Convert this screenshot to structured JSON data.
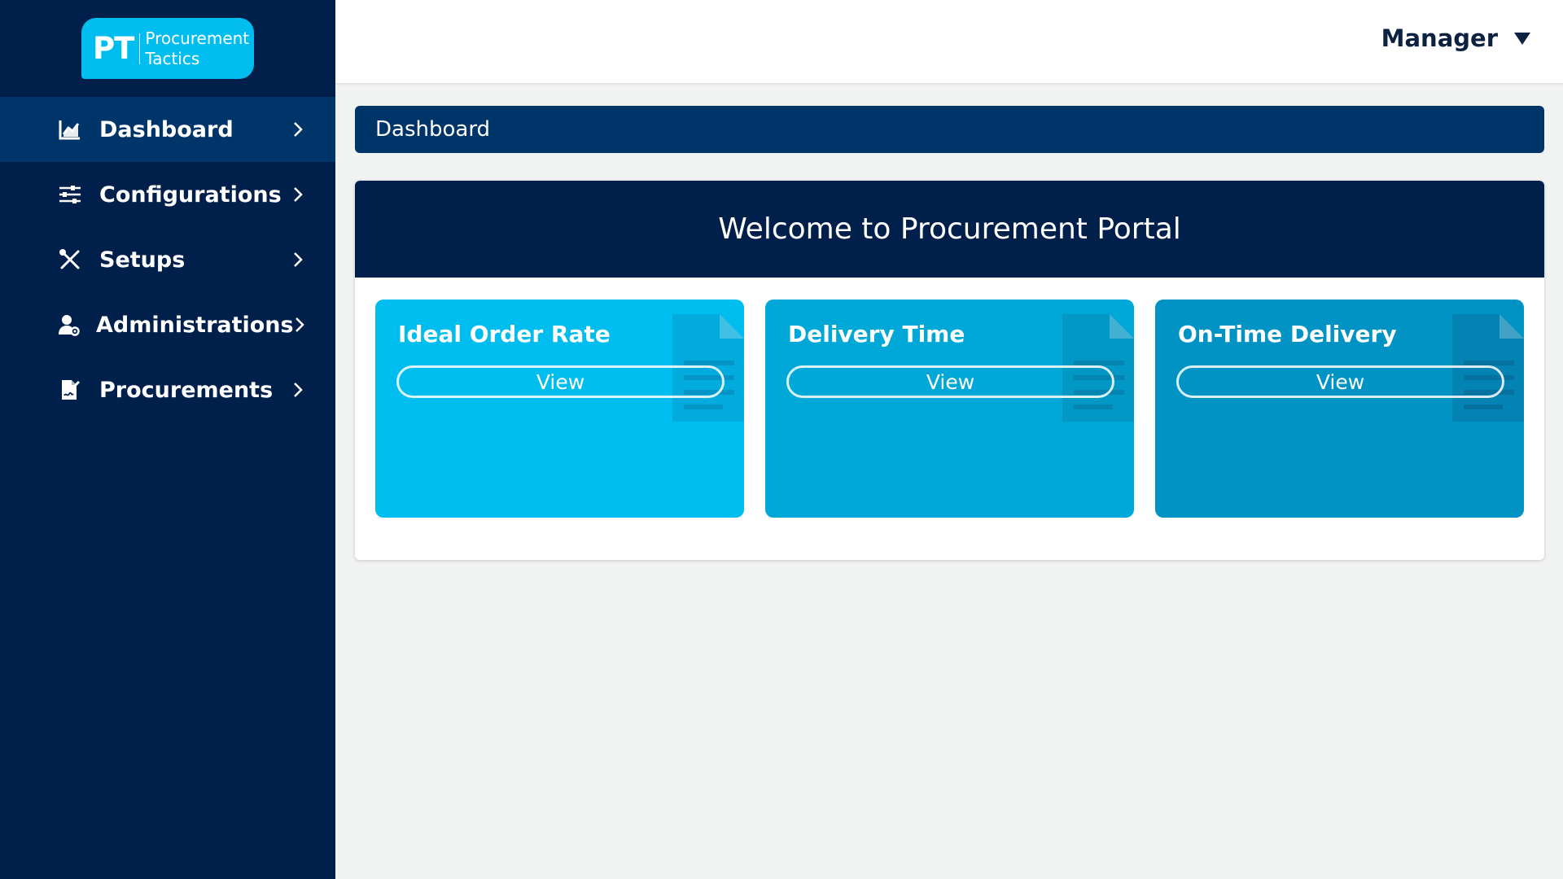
{
  "logo": {
    "mark": "PT",
    "line1": "Procurement",
    "line2": "Tactics"
  },
  "sidebar": {
    "items": [
      {
        "label": "Dashboard",
        "icon": "chart-line-icon",
        "active": true
      },
      {
        "label": "Configurations",
        "icon": "sliders-icon",
        "active": false
      },
      {
        "label": "Setups",
        "icon": "tools-icon",
        "active": false
      },
      {
        "label": "Administrations",
        "icon": "user-gear-icon",
        "active": false
      },
      {
        "label": "Procurements",
        "icon": "file-signature-icon",
        "active": false
      }
    ]
  },
  "header": {
    "user": "Manager",
    "caret_icon": "caret-down-icon"
  },
  "breadcrumb": {
    "label": "Dashboard"
  },
  "welcome": {
    "title": "Welcome to Procurement Portal"
  },
  "cards": [
    {
      "title": "Ideal Order Rate",
      "button": "View",
      "color": "#00bdf0"
    },
    {
      "title": "Delivery Time",
      "button": "View",
      "color": "#00a8d8"
    },
    {
      "title": "On-Time Delivery",
      "button": "View",
      "color": "#0093c4"
    }
  ],
  "colors": {
    "sidebar_bg": "#001f4a",
    "active_item": "#00356a",
    "breadcrumb_bg": "#00356a",
    "panel_header": "#001f4a",
    "logo_bg": "#00bdf0",
    "page_bg": "#f1f2f2"
  }
}
